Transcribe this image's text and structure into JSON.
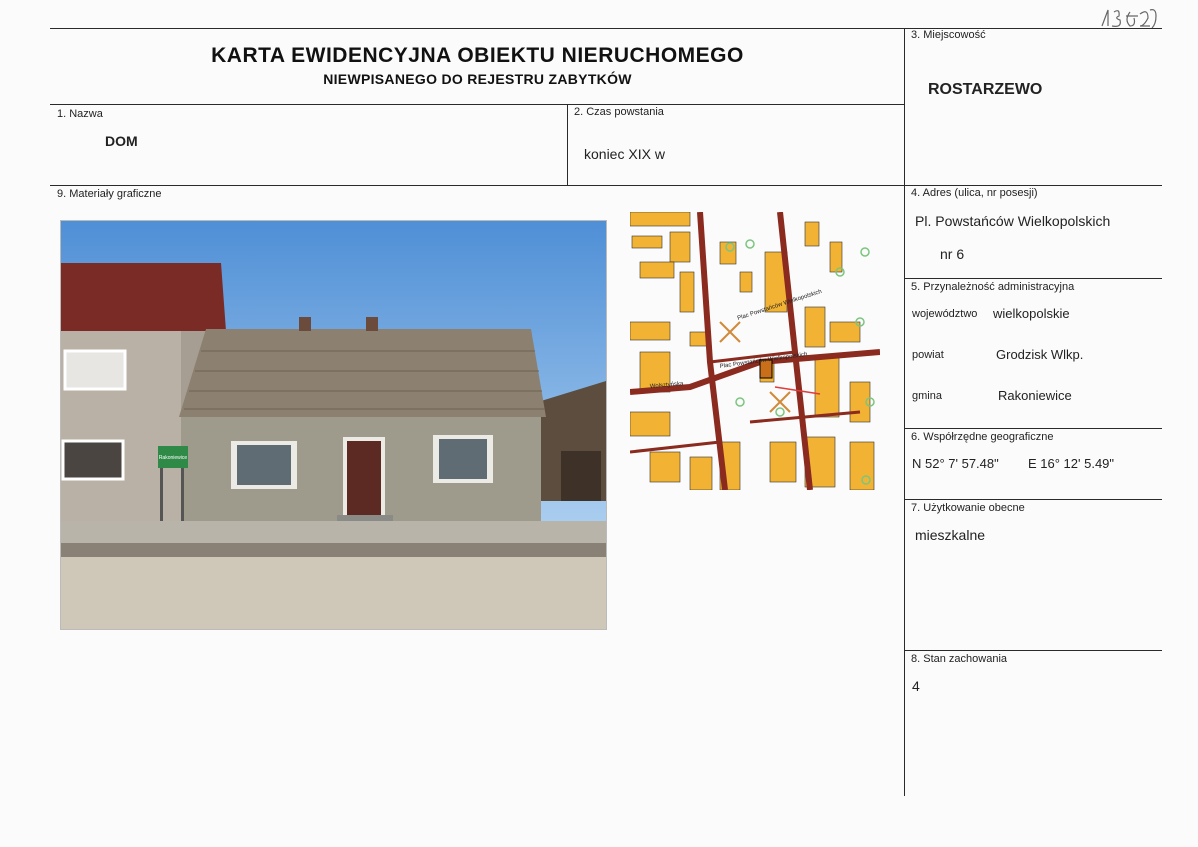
{
  "header": {
    "title": "KARTA EWIDENCYJNA OBIEKTU NIERUCHOMEGO",
    "subtitle": "NIEWPISANEGO DO REJESTRU ZABYTKÓW",
    "handwritten_number": "13062"
  },
  "fields": {
    "nazwa": {
      "label": "1. Nazwa",
      "value": "DOM"
    },
    "czas": {
      "label": "2. Czas powstania",
      "value": "koniec XIX w"
    },
    "miejscowosc": {
      "label": "3. Miejscowość",
      "value": "ROSTARZEWO"
    },
    "adres": {
      "label": "4. Adres (ulica, nr posesji)",
      "street": "Pl. Powstańców Wielkopolskich",
      "number": "nr  6"
    },
    "przynaleznosc": {
      "label": "5. Przynależność administracyjna",
      "wojewodztwo_label": "województwo",
      "wojewodztwo": "wielkopolskie",
      "powiat_label": "powiat",
      "powiat": "Grodzisk Wlkp.",
      "gmina_label": "gmina",
      "gmina": "Rakoniewice"
    },
    "wspolrzedne": {
      "label": "6. Współrzędne geograficzne",
      "n": "N  52° 7' 57.48\"",
      "e": "E 16° 12' 5.49\""
    },
    "uzytkowanie": {
      "label": "7. Użytkowanie obecne",
      "value": "mieszkalne"
    },
    "stan": {
      "label": "8. Stan zachowania",
      "value": "4"
    },
    "materialy": {
      "label": "9. Materiały graficzne"
    }
  },
  "photo": {
    "sign_text": "Rakoniewice"
  },
  "map": {
    "street_labels": [
      "Plac Powstańców Wielkopolskich",
      "Plac Powstańców Wielkopolskich",
      "Wolsztyńska"
    ],
    "colors": {
      "building": "#f2b233",
      "road": "#8b2a1e",
      "green": "#9fd39a"
    }
  }
}
